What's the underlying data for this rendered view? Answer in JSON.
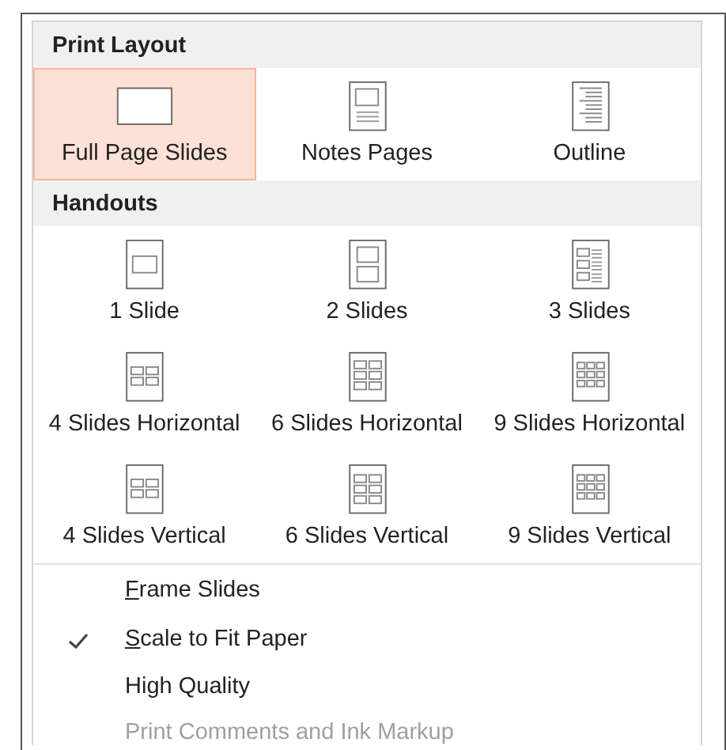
{
  "sections": [
    {
      "title": "Print Layout",
      "items": [
        {
          "label": "Full Page Slides",
          "kind": "full",
          "selected": true
        },
        {
          "label": "Notes Pages",
          "kind": "notes",
          "selected": false
        },
        {
          "label": "Outline",
          "kind": "outline",
          "selected": false
        }
      ]
    },
    {
      "title": "Handouts",
      "items": [
        {
          "label": "1 Slide",
          "kind": "h1",
          "selected": false
        },
        {
          "label": "2 Slides",
          "kind": "h2",
          "selected": false
        },
        {
          "label": "3 Slides",
          "kind": "h3",
          "selected": false
        },
        {
          "label": "4 Slides Horizontal",
          "kind": "h4h",
          "selected": false
        },
        {
          "label": "6 Slides Horizontal",
          "kind": "h6h",
          "selected": false
        },
        {
          "label": "9 Slides Horizontal",
          "kind": "h9h",
          "selected": false
        },
        {
          "label": "4 Slides Vertical",
          "kind": "h4v",
          "selected": false
        },
        {
          "label": "6 Slides Vertical",
          "kind": "h6v",
          "selected": false
        },
        {
          "label": "9 Slides Vertical",
          "kind": "h9v",
          "selected": false
        }
      ]
    }
  ],
  "options": [
    {
      "label": "Frame Slides",
      "checked": false,
      "disabled": false,
      "access_key_underlined": true
    },
    {
      "label": "Scale to Fit Paper",
      "checked": true,
      "disabled": false,
      "access_key_underlined": true
    },
    {
      "label": "High Quality",
      "checked": false,
      "disabled": false,
      "access_key_underlined": false
    },
    {
      "label": "Print Comments and Ink Markup",
      "checked": false,
      "disabled": true,
      "access_key_underlined": false
    }
  ]
}
